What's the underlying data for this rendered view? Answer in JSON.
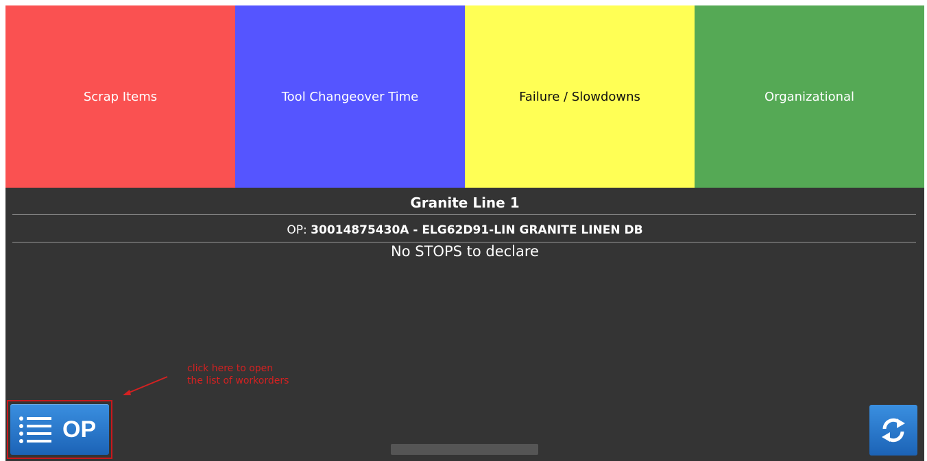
{
  "categories": [
    {
      "label": "Scrap Items",
      "bg": "#fa5151",
      "fg": "#ffffff"
    },
    {
      "label": "Tool Changeover Time",
      "bg": "#5555ff",
      "fg": "#ffffff"
    },
    {
      "label": "Failure / Slowdowns",
      "bg": "#ffff55",
      "fg": "#111111"
    },
    {
      "label": "Organizational",
      "bg": "#55a955",
      "fg": "#ffffff"
    }
  ],
  "line_title": "Granite Line 1",
  "op": {
    "prefix": "OP:",
    "value": "30014875430A - ELG62D91-LIN GRANITE LINEN DB"
  },
  "status_message": "No STOPS to declare",
  "annotation": {
    "line1": "click here to open",
    "line2": "the list of workorders",
    "color": "#d42121"
  },
  "buttons": {
    "op_label": "OP",
    "op_icon": "list-icon",
    "refresh_icon": "refresh-icon"
  },
  "colors": {
    "panel_bg": "#343434",
    "button_blue": "#2a7bd0"
  }
}
